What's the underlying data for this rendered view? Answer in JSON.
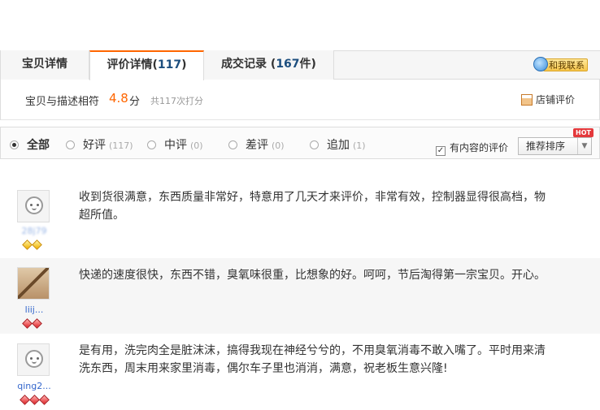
{
  "tabs": {
    "detail": "宝贝详情",
    "reviews_label": "评价详情(",
    "reviews_count": "117",
    "reviews_close": ")",
    "records_label": "成交记录 (",
    "records_count": "167",
    "records_close": "件)",
    "contact": "和我联系"
  },
  "score": {
    "label": "宝贝与描述相符",
    "value": "4.8",
    "unit": "分",
    "total": "共117次打分",
    "shop_review": "店铺评价"
  },
  "filter": {
    "options": [
      {
        "label": "全部",
        "count": "",
        "selected": true
      },
      {
        "label": "好评",
        "count": "(117)",
        "selected": false
      },
      {
        "label": "中评",
        "count": "(0)",
        "selected": false
      },
      {
        "label": "差评",
        "count": "(0)",
        "selected": false
      },
      {
        "label": "追加",
        "count": "(1)",
        "selected": false
      }
    ],
    "has_content_label": "有内容的评价",
    "has_content_checked": true,
    "sort_label": "推荐排序",
    "hot_badge": "HOT"
  },
  "reviews": [
    {
      "username": "28j79",
      "gem_color": "yellow",
      "gem_count": 2,
      "text": "收到货很满意，东西质量非常好，特意用了几天才来评价，非常有效，控制器显得很高档，物超所值。"
    },
    {
      "username": "liij...",
      "gem_color": "red",
      "gem_count": 2,
      "text": "快递的速度很快，东西不错，臭氧味很重，比想象的好。呵呵，节后淘得第一宗宝贝。开心。"
    },
    {
      "username": "qing2...",
      "gem_color": "red",
      "gem_count": 3,
      "text": "是有用，洗完肉全是脏沫沫，搞得我现在神经兮兮的，不用臭氧消毒不敢入嘴了。平时用来清洗东西，周末用来家里消毒，偶尔车子里也消消，满意，祝老板生意兴隆!"
    }
  ]
}
